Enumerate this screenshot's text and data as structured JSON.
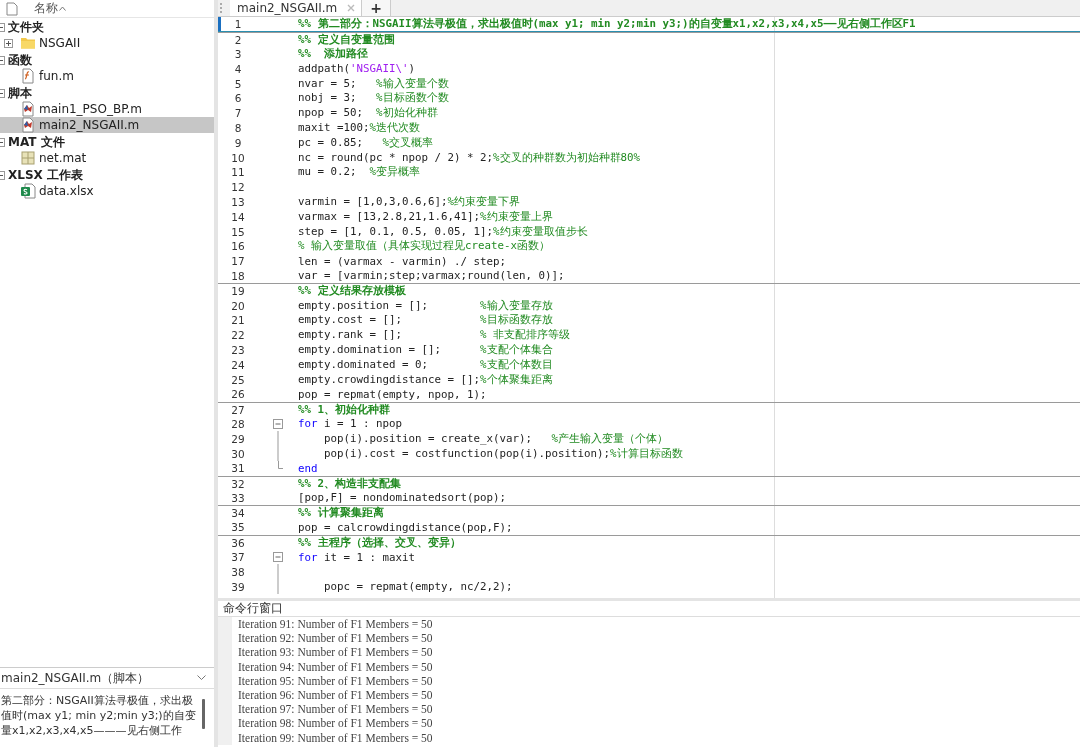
{
  "sidebar": {
    "header": "名称",
    "groups": [
      {
        "label": "文件夹",
        "expanded": true,
        "items": [
          {
            "label": "NSGAII",
            "kind": "folder",
            "expanded": false,
            "selected": false
          }
        ]
      },
      {
        "label": "函数",
        "expanded": true,
        "items": [
          {
            "label": "fun.m",
            "kind": "function",
            "selected": false
          }
        ]
      },
      {
        "label": "脚本",
        "expanded": true,
        "items": [
          {
            "label": "main1_PSO_BP.m",
            "kind": "script",
            "selected": false
          },
          {
            "label": "main2_NSGAII.m",
            "kind": "script",
            "selected": true
          }
        ]
      },
      {
        "label": "MAT 文件",
        "expanded": true,
        "items": [
          {
            "label": "net.mat",
            "kind": "mat",
            "selected": false
          }
        ]
      },
      {
        "label": "XLSX 工作表",
        "expanded": true,
        "items": [
          {
            "label": "data.xlsx",
            "kind": "sheet",
            "selected": false
          }
        ]
      }
    ]
  },
  "details": {
    "title": "main2_NSGAII.m（脚本）",
    "description": "第二部分：NSGAII算法寻极值，求出极值时(max y1; min y2;min y3;)的自变量x1,x2,x3,x4,x5———见右侧工作"
  },
  "editor": {
    "tabs": [
      {
        "label": "main2_NSGAII.m",
        "selected": true
      }
    ],
    "new_tab": "+",
    "lines": [
      {
        "n": "1",
        "current": true,
        "parts": [
          {
            "kind": "section",
            "text": "%% 第二部分：NSGAII算法寻极值，求出极值时(max y1; min y2;min y3;)的自变量x1,x2,x3,x4,x5——见右侧工作区F1"
          }
        ]
      },
      {
        "n": "2",
        "cell_start": true,
        "parts": [
          {
            "kind": "section",
            "text": "%% 定义自变量范围"
          }
        ]
      },
      {
        "n": "3",
        "parts": [
          {
            "kind": "section",
            "text": "%%  添加路径"
          }
        ]
      },
      {
        "n": "4",
        "parts": [
          {
            "kind": "code",
            "text": "addpath("
          },
          {
            "kind": "string",
            "text": "'NSGAII\\'"
          },
          {
            "kind": "code",
            "text": ")"
          }
        ]
      },
      {
        "n": "5",
        "parts": [
          {
            "kind": "code",
            "text": "nvar = 5;   "
          },
          {
            "kind": "comment",
            "text": "%输入变量个数"
          }
        ]
      },
      {
        "n": "6",
        "parts": [
          {
            "kind": "code",
            "text": "nobj = 3;   "
          },
          {
            "kind": "comment",
            "text": "%目标函数个数"
          }
        ]
      },
      {
        "n": "7",
        "parts": [
          {
            "kind": "code",
            "text": "npop = 50;  "
          },
          {
            "kind": "comment",
            "text": "%初始化种群"
          }
        ]
      },
      {
        "n": "8",
        "parts": [
          {
            "kind": "code",
            "text": "maxit =100;"
          },
          {
            "kind": "comment",
            "text": "%迭代次数"
          }
        ]
      },
      {
        "n": "9",
        "parts": [
          {
            "kind": "code",
            "text": "pc = 0.85;   "
          },
          {
            "kind": "comment",
            "text": "%交叉概率"
          }
        ]
      },
      {
        "n": "10",
        "parts": [
          {
            "kind": "code",
            "text": "nc = round(pc * npop / 2) * 2;"
          },
          {
            "kind": "comment",
            "text": "%交叉的种群数为初始种群80%"
          }
        ]
      },
      {
        "n": "11",
        "parts": [
          {
            "kind": "code",
            "text": "mu = 0.2;  "
          },
          {
            "kind": "comment",
            "text": "%变异概率"
          }
        ]
      },
      {
        "n": "12"
      },
      {
        "n": "13",
        "parts": [
          {
            "kind": "code",
            "text": "varmin = [1,0,3,0.6,6];"
          },
          {
            "kind": "comment",
            "text": "%约束变量下界"
          }
        ]
      },
      {
        "n": "14",
        "parts": [
          {
            "kind": "code",
            "text": "varmax = [13,2.8,21,1.6,41];"
          },
          {
            "kind": "comment",
            "text": "%约束变量上界"
          }
        ]
      },
      {
        "n": "15",
        "parts": [
          {
            "kind": "code",
            "text": "step = [1, 0.1, 0.5, 0.05, 1];"
          },
          {
            "kind": "comment",
            "text": "%约束变量取值步长"
          }
        ]
      },
      {
        "n": "16",
        "parts": [
          {
            "kind": "comment",
            "text": "% 输入变量取值（具体实现过程见create-x函数）"
          }
        ]
      },
      {
        "n": "17",
        "parts": [
          {
            "kind": "code",
            "text": "len = (varmax - varmin) ./ step;"
          }
        ]
      },
      {
        "n": "18",
        "parts": [
          {
            "kind": "code",
            "text": "var = [varmin;step;varmax;round(len, 0)];"
          }
        ]
      },
      {
        "n": "19",
        "cell_start": true,
        "parts": [
          {
            "kind": "section",
            "text": "%% 定义结果存放模板"
          }
        ]
      },
      {
        "n": "20",
        "parts": [
          {
            "kind": "code",
            "text": "empty.position = [];        "
          },
          {
            "kind": "comment",
            "text": "%输入变量存放"
          }
        ]
      },
      {
        "n": "21",
        "parts": [
          {
            "kind": "code",
            "text": "empty.cost = [];            "
          },
          {
            "kind": "comment",
            "text": "%目标函数存放"
          }
        ]
      },
      {
        "n": "22",
        "parts": [
          {
            "kind": "code",
            "text": "empty.rank = [];            "
          },
          {
            "kind": "comment",
            "text": "% 非支配排序等级"
          }
        ]
      },
      {
        "n": "23",
        "parts": [
          {
            "kind": "code",
            "text": "empty.domination = [];      "
          },
          {
            "kind": "comment",
            "text": "%支配个体集合"
          }
        ]
      },
      {
        "n": "24",
        "parts": [
          {
            "kind": "code",
            "text": "empty.dominated = 0;        "
          },
          {
            "kind": "comment",
            "text": "%支配个体数目"
          }
        ]
      },
      {
        "n": "25",
        "parts": [
          {
            "kind": "code",
            "text": "empty.crowdingdistance = [];"
          },
          {
            "kind": "comment",
            "text": "%个体聚集距离"
          }
        ]
      },
      {
        "n": "26",
        "parts": [
          {
            "kind": "code",
            "text": "pop = repmat(empty, npop, 1);"
          }
        ]
      },
      {
        "n": "27",
        "cell_start": true,
        "parts": [
          {
            "kind": "section",
            "text": "%% 1、初始化种群"
          }
        ]
      },
      {
        "n": "28",
        "fold_start": true,
        "parts": [
          {
            "kind": "keyword",
            "text": "for"
          },
          {
            "kind": "code",
            "text": " i = 1 : npop"
          }
        ]
      },
      {
        "n": "29",
        "in_fold": true,
        "parts": [
          {
            "kind": "code",
            "text": "    pop(i).position = create_x(var);   "
          },
          {
            "kind": "comment",
            "text": "%产生输入变量（个体）"
          }
        ]
      },
      {
        "n": "30",
        "in_fold": true,
        "parts": [
          {
            "kind": "code",
            "text": "    pop(i).cost = costfunction(pop(i).position);"
          },
          {
            "kind": "comment",
            "text": "%计算目标函数"
          }
        ]
      },
      {
        "n": "31",
        "fold_end": true,
        "parts": [
          {
            "kind": "keyword",
            "text": "end"
          }
        ]
      },
      {
        "n": "32",
        "cell_start": true,
        "parts": [
          {
            "kind": "section",
            "text": "%% 2、构造非支配集"
          }
        ]
      },
      {
        "n": "33",
        "parts": [
          {
            "kind": "code",
            "text": "[pop,F] = nondominatedsort(pop);"
          }
        ]
      },
      {
        "n": "34",
        "cell_start": true,
        "parts": [
          {
            "kind": "section",
            "text": "%% 计算聚集距离"
          }
        ]
      },
      {
        "n": "35",
        "parts": [
          {
            "kind": "code",
            "text": "pop = calcrowdingdistance(pop,F);"
          }
        ]
      },
      {
        "n": "36",
        "cell_start": true,
        "parts": [
          {
            "kind": "section",
            "text": "%% 主程序（选择、交叉、变异）"
          }
        ]
      },
      {
        "n": "37",
        "fold_start": true,
        "parts": [
          {
            "kind": "keyword",
            "text": "for"
          },
          {
            "kind": "code",
            "text": " it = 1 : maxit"
          }
        ]
      },
      {
        "n": "38",
        "in_fold": true
      },
      {
        "n": "39",
        "in_fold": true,
        "parts": [
          {
            "kind": "code",
            "text": "    popc = repmat(empty, nc/2,2);"
          }
        ]
      }
    ]
  },
  "command_window": {
    "title": "命令行窗口",
    "lines": [
      "Iteration 91: Number of F1 Members = 50",
      "Iteration 92: Number of F1 Members = 50",
      "Iteration 93: Number of F1 Members = 50",
      "Iteration 94: Number of F1 Members = 50",
      "Iteration 95: Number of F1 Members = 50",
      "Iteration 96: Number of F1 Members = 50",
      "Iteration 97: Number of F1 Members = 50",
      "Iteration 98: Number of F1 Members = 50",
      "Iteration 99: Number of F1 Members = 50"
    ]
  }
}
